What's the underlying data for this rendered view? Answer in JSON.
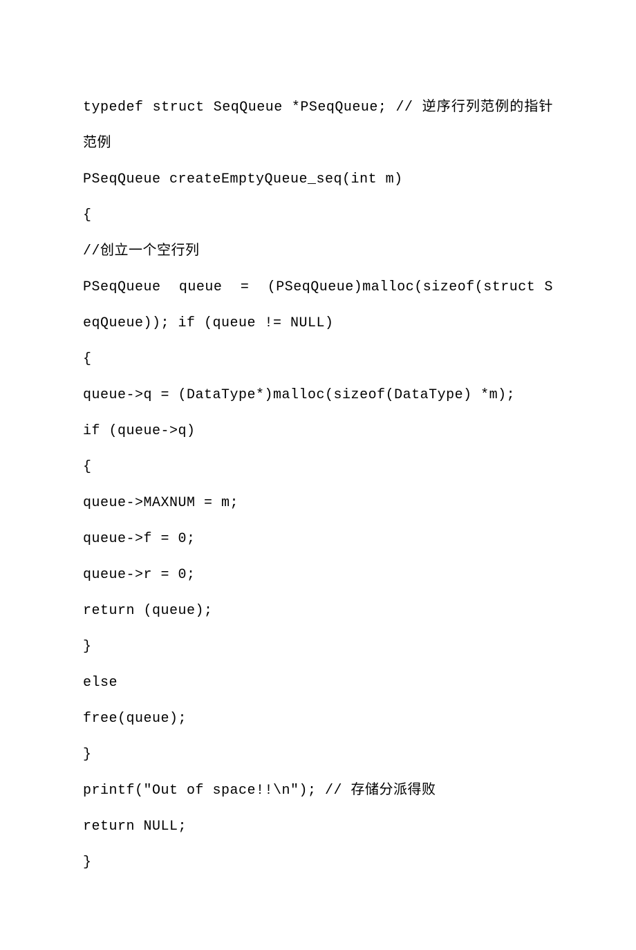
{
  "lines": [
    {
      "text": "typedef struct SeqQueue *PSeqQueue; // 逆序行列范例的指针范例",
      "justify": true
    },
    {
      "text": "PSeqQueue createEmptyQueue_seq(int m)"
    },
    {
      "text": "{"
    },
    {
      "text": "//创立一个空行列"
    },
    {
      "text": "PSeqQueue  queue  =  (PSeqQueue)malloc(sizeof(struct SeqQueue)); if (queue != NULL)",
      "justify": true
    },
    {
      "text": "{"
    },
    {
      "text": "queue->q = (DataType*)malloc(sizeof(DataType) *m);"
    },
    {
      "text": "if (queue->q)"
    },
    {
      "text": "{"
    },
    {
      "text": "queue->MAXNUM = m;"
    },
    {
      "text": "queue->f = 0;"
    },
    {
      "text": "queue->r = 0;"
    },
    {
      "text": "return (queue);"
    },
    {
      "text": "}"
    },
    {
      "text": "else"
    },
    {
      "text": "free(queue);"
    },
    {
      "text": "}"
    },
    {
      "text": "printf(\"Out of space!!\\n\"); // 存储分派得败"
    },
    {
      "text": "return NULL;"
    },
    {
      "text": "}"
    }
  ]
}
